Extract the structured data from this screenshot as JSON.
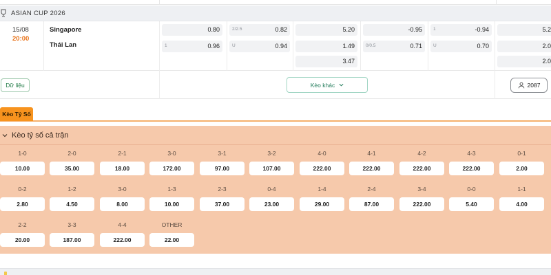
{
  "league": {
    "name": "ASIAN CUP 2026",
    "icon": "league-cup-icon"
  },
  "match": {
    "date": "15/08",
    "time": "20:00",
    "home": "Singapore",
    "away": "Thái Lan",
    "odds": {
      "c1": [
        "0.80",
        "0.96"
      ],
      "c1_hc": [
        "",
        "1"
      ],
      "c2": [
        "0.82",
        "0.94"
      ],
      "c2_hc": [
        "2/2.5",
        "U"
      ],
      "c3": [
        "5.20",
        "1.49",
        "3.47"
      ],
      "c4": [
        "-0.95",
        "0.71"
      ],
      "c4_hc": [
        "",
        "0/0.5"
      ],
      "c5": [
        "-0.94",
        "0.70"
      ],
      "c5_hc": [
        "1",
        "U"
      ],
      "c6": [
        "5.2",
        "2.0",
        "2.0"
      ]
    }
  },
  "actions": {
    "data_label": "Dữ liệu",
    "more_label": "Kèo khác",
    "count": "2087"
  },
  "tab": {
    "label": "Kèo Tỷ Số"
  },
  "panel": {
    "title": "Kèo tỷ số cả trận",
    "scores": [
      {
        "label": "1-0",
        "odd": "10.00"
      },
      {
        "label": "2-0",
        "odd": "35.00"
      },
      {
        "label": "2-1",
        "odd": "18.00"
      },
      {
        "label": "3-0",
        "odd": "172.00"
      },
      {
        "label": "3-1",
        "odd": "97.00"
      },
      {
        "label": "3-2",
        "odd": "107.00"
      },
      {
        "label": "4-0",
        "odd": "222.00"
      },
      {
        "label": "4-1",
        "odd": "222.00"
      },
      {
        "label": "4-2",
        "odd": "222.00"
      },
      {
        "label": "4-3",
        "odd": "222.00"
      },
      {
        "label": "0-1",
        "odd": "2.00"
      },
      {
        "label": "0-2",
        "odd": "2.80"
      },
      {
        "label": "1-2",
        "odd": "4.50"
      },
      {
        "label": "3-0",
        "odd": "8.00"
      },
      {
        "label": "1-3",
        "odd": "10.00"
      },
      {
        "label": "2-3",
        "odd": "37.00"
      },
      {
        "label": "0-4",
        "odd": "23.00"
      },
      {
        "label": "1-4",
        "odd": "29.00"
      },
      {
        "label": "2-4",
        "odd": "87.00"
      },
      {
        "label": "3-4",
        "odd": "222.00"
      },
      {
        "label": "0-0",
        "odd": "5.40"
      },
      {
        "label": "1-1",
        "odd": "4.00"
      },
      {
        "label": "2-2",
        "odd": "20.00"
      },
      {
        "label": "3-3",
        "odd": "187.00"
      },
      {
        "label": "4-4",
        "odd": "222.00"
      },
      {
        "label": "OTHER",
        "odd": "22.00"
      }
    ]
  },
  "colors": {
    "accent_orange": "#f7931e",
    "panel_bg": "#f6c9ab",
    "time_orange": "#e8731a",
    "green_text": "#1f7a45"
  }
}
